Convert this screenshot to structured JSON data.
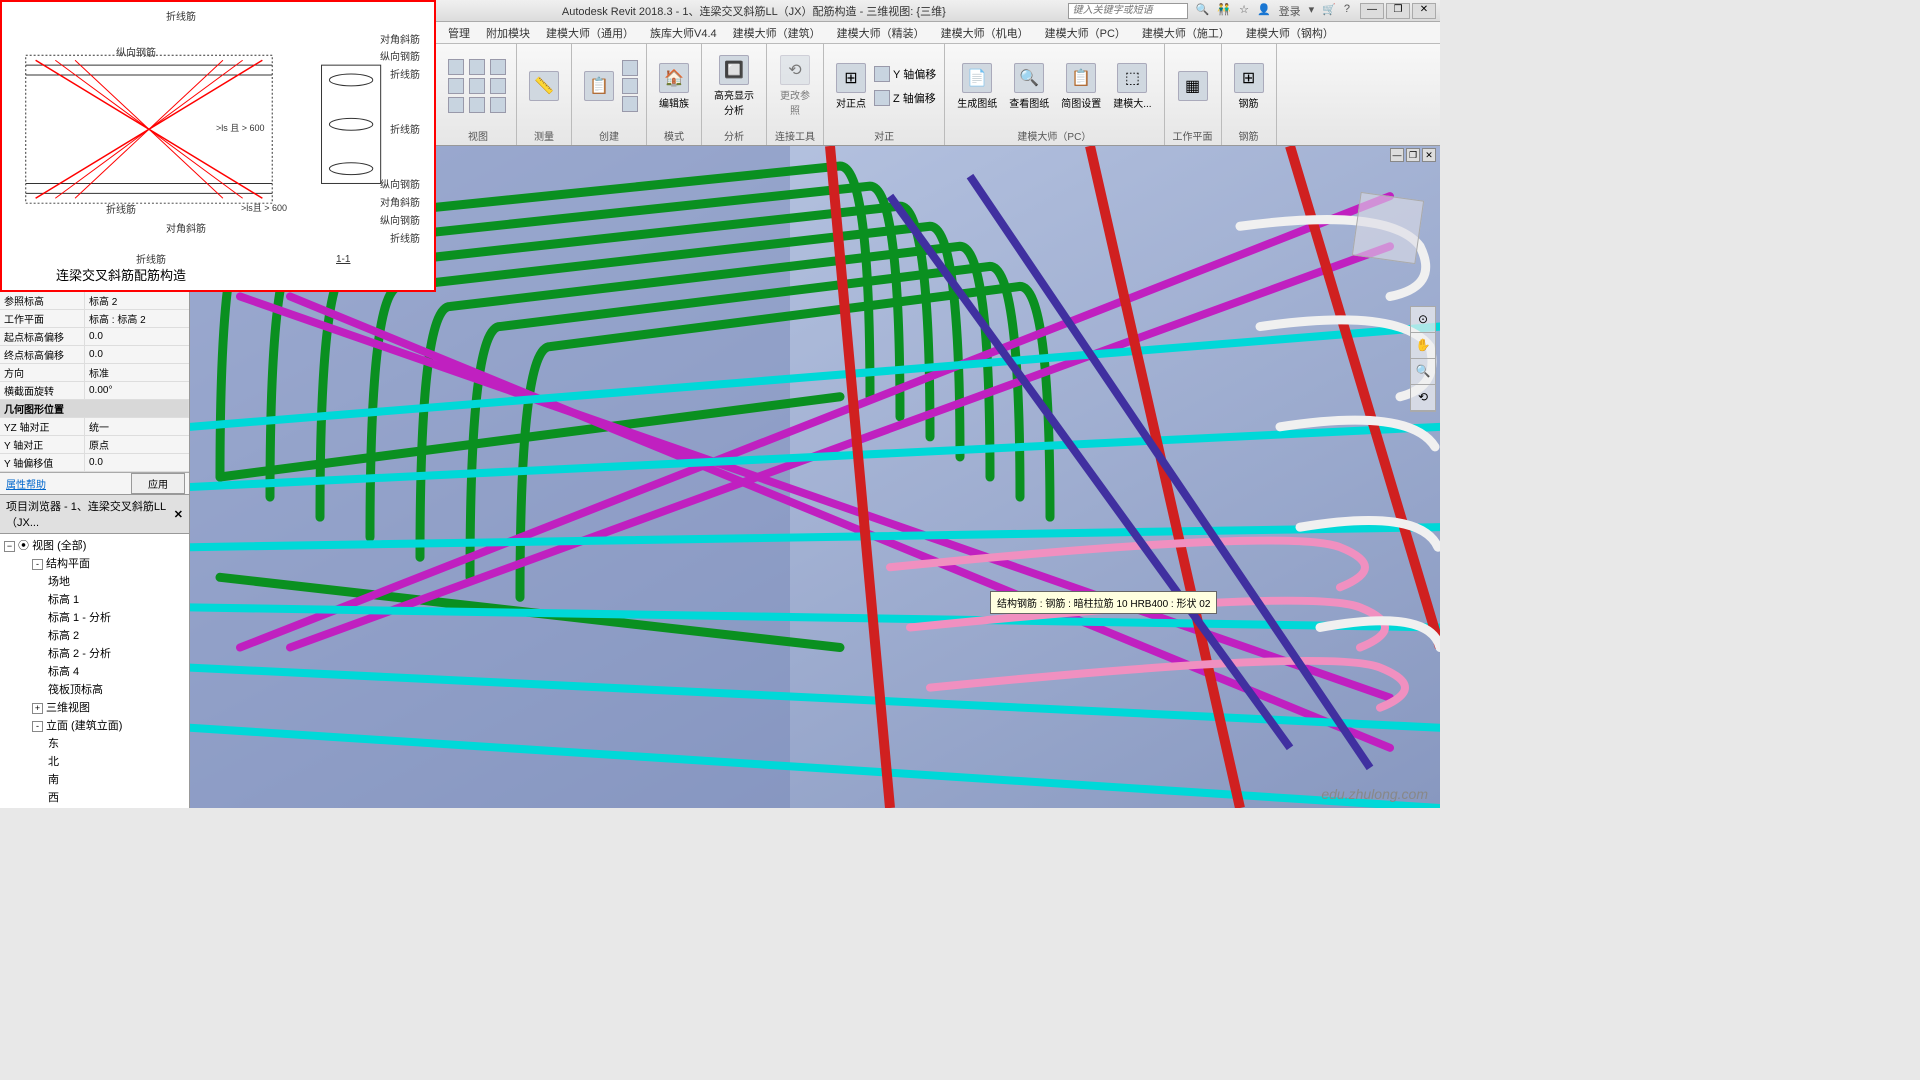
{
  "title": "Autodesk Revit 2018.3 -   1、连梁交叉斜筋LL（JX）配筋构造 - 三维视图: {三维}",
  "search_placeholder": "键入关键字或短语",
  "login_text": "登录",
  "ribbon_tabs": [
    "管理",
    "附加模块",
    "建模大师（通用）",
    "族库大师V4.4",
    "建模大师（建筑）",
    "建模大师（精装）",
    "建模大师（机电）",
    "建模大师（PC）",
    "建模大师（施工）",
    "建模大师（钢构）"
  ],
  "ribbon_groups": {
    "g1": {
      "label": "视图"
    },
    "g2": {
      "label": "测量"
    },
    "g3": {
      "label": "创建"
    },
    "g4": {
      "label": "模式",
      "btns": [
        "编辑族"
      ]
    },
    "g5": {
      "label": "分析",
      "btns": [
        "高亮显示分析"
      ]
    },
    "g6": {
      "label": "连接工具",
      "btns": [
        "更改参照"
      ]
    },
    "g7": {
      "label": "对正",
      "btns": [
        "对正点",
        "Y 轴偏移",
        "Z 轴偏移"
      ]
    },
    "g8": {
      "label": "建模大师（PC）",
      "btns": [
        "生成图纸",
        "查看图纸",
        "简图设置",
        "建模大..."
      ]
    },
    "g9": {
      "label": "工作平面"
    },
    "g10": {
      "label": "钢筋",
      "btns": [
        "钢筋"
      ]
    }
  },
  "diagram": {
    "title": "连梁交叉斜筋配筋构造",
    "labels": [
      "折线筋",
      "纵向钢筋",
      "对角斜筋",
      "纵向钢筋",
      "折线筋",
      "折线筋",
      "折线筋",
      "折线筋",
      "折线筋",
      "纵向钢筋",
      "对角斜筋",
      "纵向钢筋",
      "对角斜筋",
      "折线筋"
    ],
    "section": "1-1",
    "dim1": ">ls 且 > 600",
    "dim2": ">ls且 > 600"
  },
  "properties": {
    "rows": [
      {
        "label": "参照标高",
        "value": "标高 2"
      },
      {
        "label": "工作平面",
        "value": "标高 : 标高 2"
      },
      {
        "label": "起点标高偏移",
        "value": "0.0"
      },
      {
        "label": "终点标高偏移",
        "value": "0.0"
      },
      {
        "label": "方向",
        "value": "标准"
      },
      {
        "label": "横截面旋转",
        "value": "0.00°"
      }
    ],
    "section_header": "几何图形位置",
    "rows2": [
      {
        "label": "YZ 轴对正",
        "value": "统一"
      },
      {
        "label": "Y 轴对正",
        "value": "原点"
      },
      {
        "label": "Y 轴偏移值",
        "value": "0.0"
      }
    ],
    "help": "属性帮助",
    "apply": "应用"
  },
  "browser": {
    "title": "项目浏览器 - 1、连梁交叉斜筋LL（JX...",
    "root": "视图 (全部)",
    "items": [
      {
        "indent": 1,
        "toggle": "-",
        "text": "结构平面"
      },
      {
        "indent": 2,
        "text": "场地"
      },
      {
        "indent": 2,
        "text": "标高 1"
      },
      {
        "indent": 2,
        "text": "标高 1 - 分析"
      },
      {
        "indent": 2,
        "text": "标高 2"
      },
      {
        "indent": 2,
        "text": "标高 2 - 分析"
      },
      {
        "indent": 2,
        "text": "标高 4"
      },
      {
        "indent": 2,
        "text": "筏板顶标高"
      },
      {
        "indent": 1,
        "toggle": "+",
        "text": "三维视图"
      },
      {
        "indent": 1,
        "toggle": "-",
        "text": "立面 (建筑立面)"
      },
      {
        "indent": 2,
        "text": "东"
      },
      {
        "indent": 2,
        "text": "北"
      },
      {
        "indent": 2,
        "text": "南"
      },
      {
        "indent": 2,
        "text": "西"
      }
    ]
  },
  "tooltip_text": "结构钢筋 : 钢筋 : 暗柱拉筋 10 HRB400 : 形状 02",
  "watermark": "edu.zhulong.com"
}
